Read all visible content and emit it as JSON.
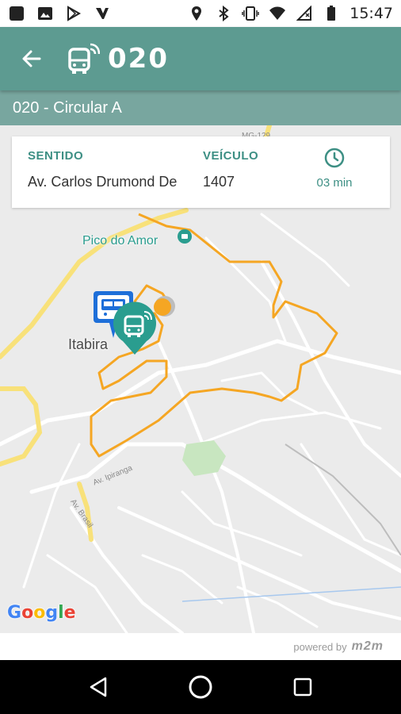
{
  "status_bar": {
    "time": "15:47",
    "left_icons": [
      "square-icon",
      "image-icon",
      "play-store-icon",
      "app-icon"
    ],
    "right_icons": [
      "location-icon",
      "bluetooth-icon",
      "vibrate-icon",
      "wifi-icon",
      "no-signal-icon",
      "battery-icon"
    ]
  },
  "app_bar": {
    "title": "020",
    "background": "#5d9b91"
  },
  "route": {
    "name": "020 - Circular A"
  },
  "info_card": {
    "direction_label": "SENTIDO",
    "direction_value": "Av. Carlos Drumond De",
    "vehicle_label": "VEÍCULO",
    "vehicle_value": "1407",
    "time_value": "03 min",
    "accent": "#3d8f84"
  },
  "map": {
    "city_label": "Itabira",
    "poi_label": "Pico do Amor",
    "street_labels": [
      "Av. Ipiranga",
      "Av. Brasil",
      "MG-129"
    ],
    "route_color": "#f5a623",
    "google_logo": [
      "G",
      "o",
      "o",
      "g",
      "l",
      "e"
    ]
  },
  "footer": {
    "powered_by": "powered by",
    "brand": "m2m"
  },
  "nav_bar": {
    "buttons": [
      "back",
      "home",
      "recents"
    ]
  }
}
